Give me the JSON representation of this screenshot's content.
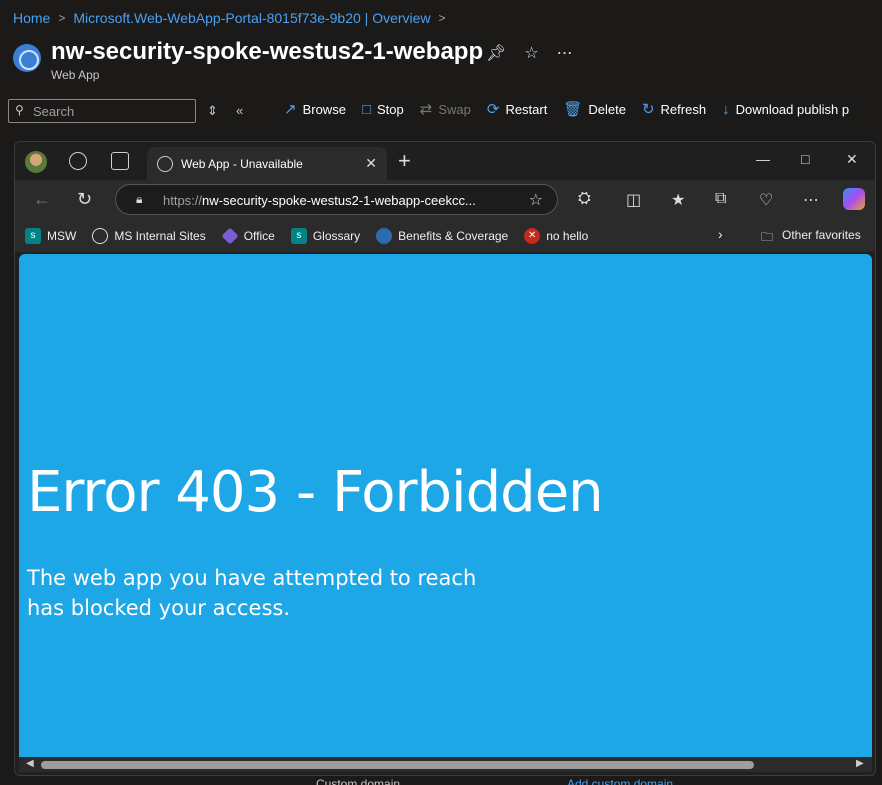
{
  "breadcrumb": {
    "home": "Home",
    "item": "Microsoft.Web-WebApp-Portal-8015f73e-9b20 | Overview"
  },
  "resource": {
    "title": "nw-security-spoke-westus2-1-webapp",
    "subtitle": "Web App"
  },
  "search": {
    "placeholder": "Search"
  },
  "commands": [
    {
      "label": "Browse",
      "icon": "external-link-icon"
    },
    {
      "label": "Stop",
      "icon": "stop-icon"
    },
    {
      "label": "Swap",
      "icon": "swap-icon"
    },
    {
      "label": "Restart",
      "icon": "restart-icon"
    },
    {
      "label": "Delete",
      "icon": "trash-icon"
    },
    {
      "label": "Refresh",
      "icon": "refresh-icon"
    },
    {
      "label": "Download publish p",
      "icon": "download-icon"
    }
  ],
  "bottom": {
    "left": "Custom domain",
    "right": "Add custom domain"
  },
  "browser": {
    "tab_title": "Web App - Unavailable",
    "url_proto": "https://",
    "url_rest": "nw-security-spoke-westus2-1-webapp-ceekcc...",
    "favorites": [
      {
        "label": "MSW",
        "icon": "sharepoint-icon",
        "color": "#038387"
      },
      {
        "label": "MS Internal Sites",
        "icon": "globe-icon",
        "color": "#555555"
      },
      {
        "label": "Office",
        "icon": "office-icon",
        "color": "#7b5cd6"
      },
      {
        "label": "Glossary",
        "icon": "sharepoint-icon",
        "color": "#038387"
      },
      {
        "label": "Benefits & Coverage",
        "icon": "benefits-icon",
        "color": "#2b6cb0"
      },
      {
        "label": "no hello",
        "icon": "block-icon",
        "color": "#c42b1c"
      }
    ],
    "other_favorites": "Other favorites"
  },
  "error": {
    "heading": "Error 403 - Forbidden",
    "message": "The web app you have attempted to reach has blocked your access."
  },
  "colors": {
    "error_bg": "#1ea7e6",
    "accent": "#4aa0f0"
  }
}
